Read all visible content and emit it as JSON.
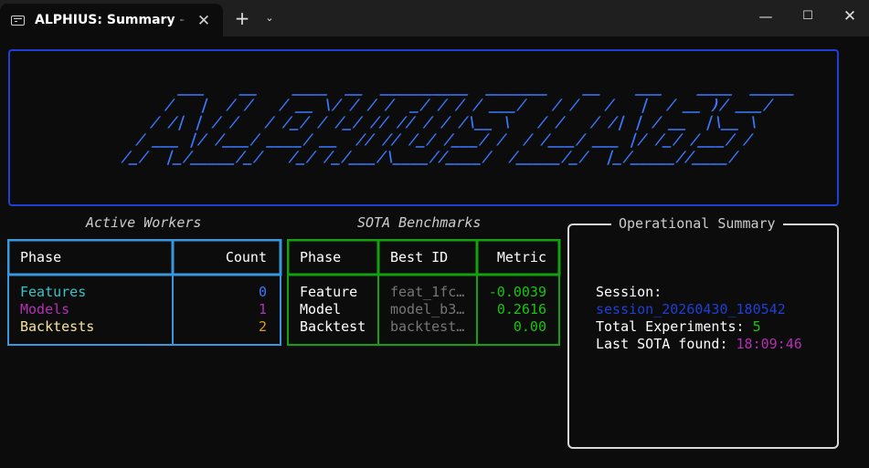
{
  "window": {
    "tab_title": "ALPHIUS: Summary - d",
    "tab_icon": "terminal-icon",
    "close_glyph": "✕",
    "new_tab_glyph": "+",
    "dropdown_glyph": "⌄",
    "minimize_glyph": "—",
    "maximize_glyph": "☐",
    "window_close_glyph": "✕"
  },
  "banner": {
    "art_lines": [
      "    ___    __    ____  __  __________  _______    __    ___    ____  _____",
      "   /   |  / /   / __ \\/ / / /  _/ / / / ___/   / /   /   |  / __ )/ ___/",
      "  / /| | / /   / /_/ / /_/ // // / / /\\__ \\   / /   / /| | / __  |\\__ \\ ",
      " / ___ |/ /___/ ____/ __  // // /_/ /___/ /  / /___/ ___ |/ /_/ /___/ / ",
      "/_/  |_/_____/_/   /_/ /_/___/\\____//____/  /_____/_/  |_/_____//____/  "
    ],
    "color": "#3b78ff",
    "border_color": "#1f3fd6"
  },
  "workers": {
    "title": "Active Workers",
    "headers": [
      "Phase",
      "Count"
    ],
    "rows": [
      {
        "phase": "Features",
        "count": "0",
        "phase_color": "#3bc4c4",
        "count_color": "#3b78ff"
      },
      {
        "phase": "Models",
        "count": "1",
        "phase_color": "#b42fb4",
        "count_color": "#b42fb4"
      },
      {
        "phase": "Backtests",
        "count": "2",
        "phase_color": "#f5e29b",
        "count_color": "#d9a020"
      }
    ],
    "border_color": "#3a96dd"
  },
  "sota": {
    "title": "SOTA Benchmarks",
    "headers": [
      "Phase",
      "Best ID",
      "Metric"
    ],
    "rows": [
      {
        "phase": "Feature",
        "best_id": "feat_1fc…",
        "metric": "-0.0039"
      },
      {
        "phase": "Model",
        "best_id": "model_b3…",
        "metric": "0.2616"
      },
      {
        "phase": "Backtest",
        "best_id": "backtest…",
        "metric": "0.00"
      }
    ],
    "border_color": "#13a10e",
    "metric_color": "#16c60c",
    "id_color": "#767676"
  },
  "summary": {
    "title": "Operational Summary",
    "session_label": "Session:",
    "session_value": "session_20260430_180542",
    "experiments_label": "Total Experiments:",
    "experiments_value": "5",
    "last_sota_label": "Last SOTA found:",
    "last_sota_value": "18:09:46",
    "session_color": "#1f3fd6",
    "experiments_color": "#16c60c",
    "last_sota_color": "#b42fb4"
  }
}
